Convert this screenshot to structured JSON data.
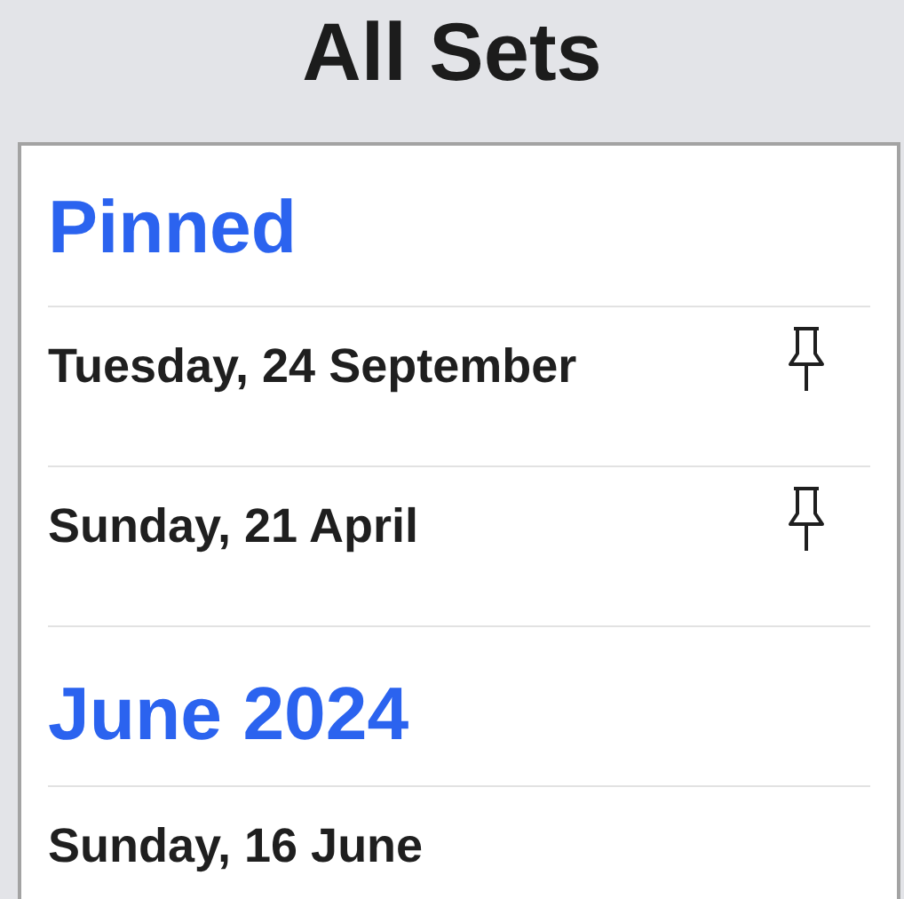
{
  "title": "All Sets",
  "sections": [
    {
      "title": "Pinned",
      "rows": [
        {
          "date": "Tuesday, 24 September",
          "pinned": true
        },
        {
          "date": "Sunday, 21 April",
          "pinned": true
        }
      ]
    },
    {
      "title": "June 2024",
      "rows": [
        {
          "date": "Sunday, 16 June",
          "pinned": false
        }
      ]
    }
  ]
}
